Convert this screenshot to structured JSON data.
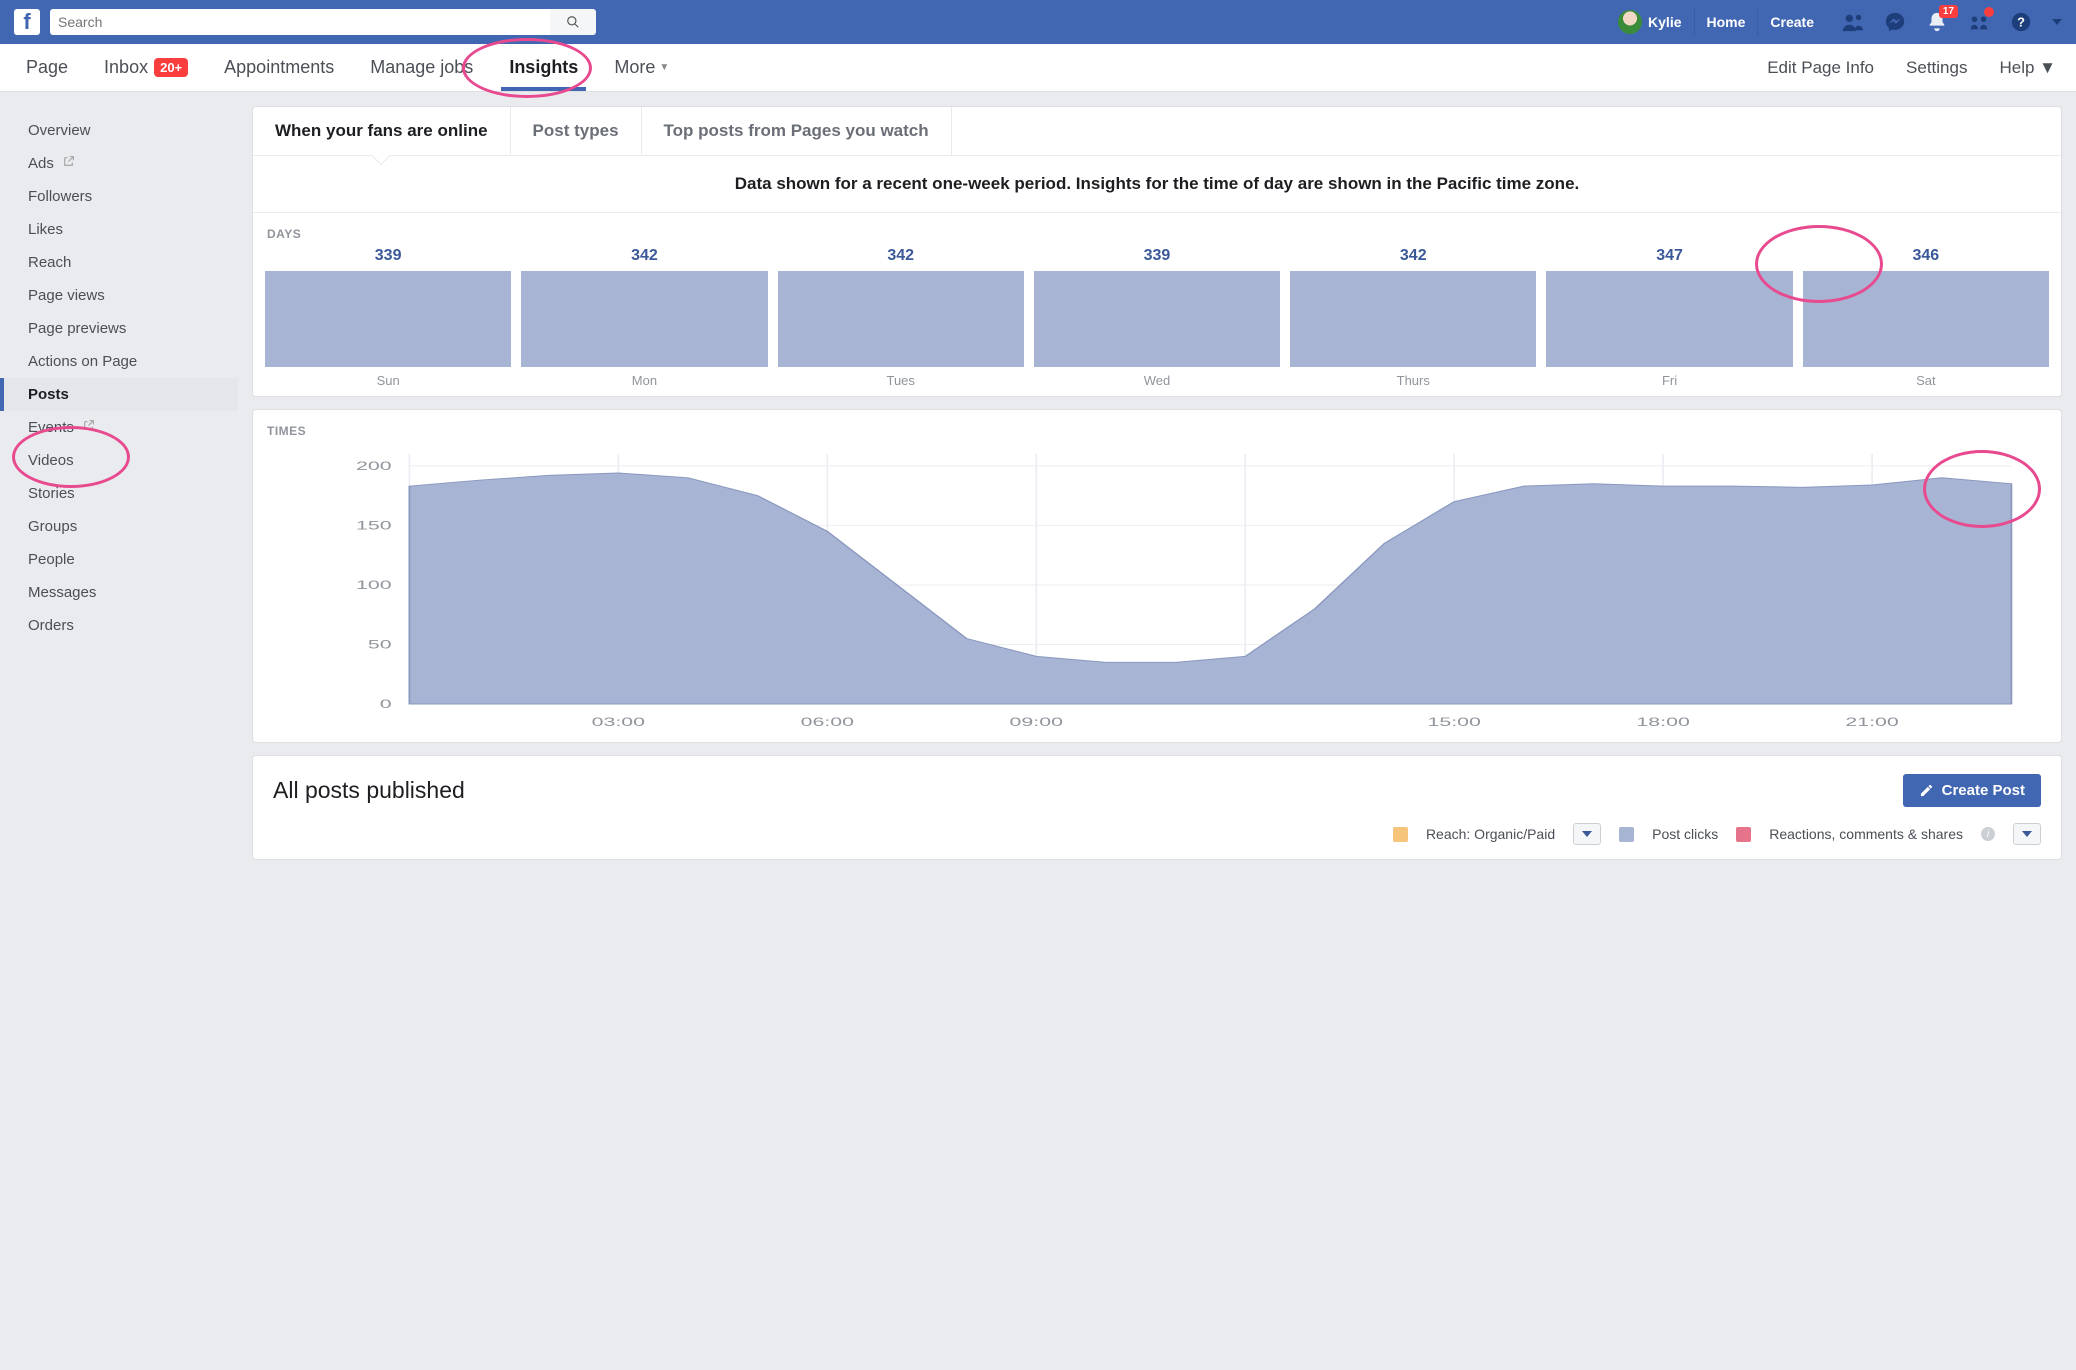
{
  "search": {
    "placeholder": "Search"
  },
  "top": {
    "profile_name": "Kylie",
    "home": "Home",
    "create": "Create",
    "notif_badge": "17"
  },
  "pagenav": {
    "items": [
      {
        "label": "Page"
      },
      {
        "label": "Inbox",
        "badge": "20+"
      },
      {
        "label": "Appointments"
      },
      {
        "label": "Manage jobs"
      },
      {
        "label": "Insights",
        "active": true
      },
      {
        "label": "More"
      }
    ],
    "right": [
      {
        "label": "Edit Page Info"
      },
      {
        "label": "Settings"
      },
      {
        "label": "Help"
      }
    ]
  },
  "sidebar": {
    "items": [
      {
        "label": "Overview"
      },
      {
        "label": "Ads",
        "ext": true
      },
      {
        "label": "Followers"
      },
      {
        "label": "Likes"
      },
      {
        "label": "Reach"
      },
      {
        "label": "Page views"
      },
      {
        "label": "Page previews"
      },
      {
        "label": "Actions on Page"
      },
      {
        "label": "Posts",
        "active": true
      },
      {
        "label": "Events",
        "ext": true
      },
      {
        "label": "Videos"
      },
      {
        "label": "Stories"
      },
      {
        "label": "Groups"
      },
      {
        "label": "People"
      },
      {
        "label": "Messages"
      },
      {
        "label": "Orders"
      }
    ]
  },
  "content_tabs": [
    {
      "label": "When your fans are online",
      "active": true
    },
    {
      "label": "Post types"
    },
    {
      "label": "Top posts from Pages you watch"
    }
  ],
  "note": "Data shown for a recent one-week period. Insights for the time of day are shown in the Pacific time zone.",
  "days_label": "DAYS",
  "times_label": "TIMES",
  "allposts": {
    "title": "All posts published",
    "button": "Create Post"
  },
  "legend": {
    "reach": "Reach: Organic/Paid",
    "clicks": "Post clicks",
    "reactions": "Reactions, comments & shares",
    "colors": {
      "reach": "#f7c47b",
      "clicks": "#a8b4d4",
      "reactions": "#e57389"
    }
  },
  "chart_data": [
    {
      "type": "bar",
      "title": "Fans online by day",
      "categories": [
        "Sun",
        "Mon",
        "Tues",
        "Wed",
        "Thurs",
        "Fri",
        "Sat"
      ],
      "values": [
        339,
        342,
        342,
        339,
        342,
        347,
        346
      ],
      "ylim": [
        0,
        350
      ]
    },
    {
      "type": "area",
      "title": "Fans online by time of day (Pacific)",
      "xlabel": "",
      "ylabel": "",
      "ylim": [
        0,
        210
      ],
      "x_ticks": [
        "03:00",
        "06:00",
        "09:00",
        "15:00",
        "18:00",
        "21:00"
      ],
      "y_ticks": [
        0,
        50,
        100,
        150,
        200
      ],
      "x": [
        "00:00",
        "01:00",
        "02:00",
        "03:00",
        "04:00",
        "05:00",
        "06:00",
        "07:00",
        "08:00",
        "09:00",
        "10:00",
        "11:00",
        "12:00",
        "13:00",
        "14:00",
        "15:00",
        "16:00",
        "17:00",
        "18:00",
        "19:00",
        "20:00",
        "21:00",
        "22:00",
        "23:00"
      ],
      "values": [
        183,
        188,
        192,
        194,
        190,
        175,
        145,
        100,
        55,
        40,
        35,
        35,
        40,
        80,
        135,
        170,
        183,
        185,
        183,
        183,
        182,
        184,
        190,
        185
      ]
    }
  ]
}
